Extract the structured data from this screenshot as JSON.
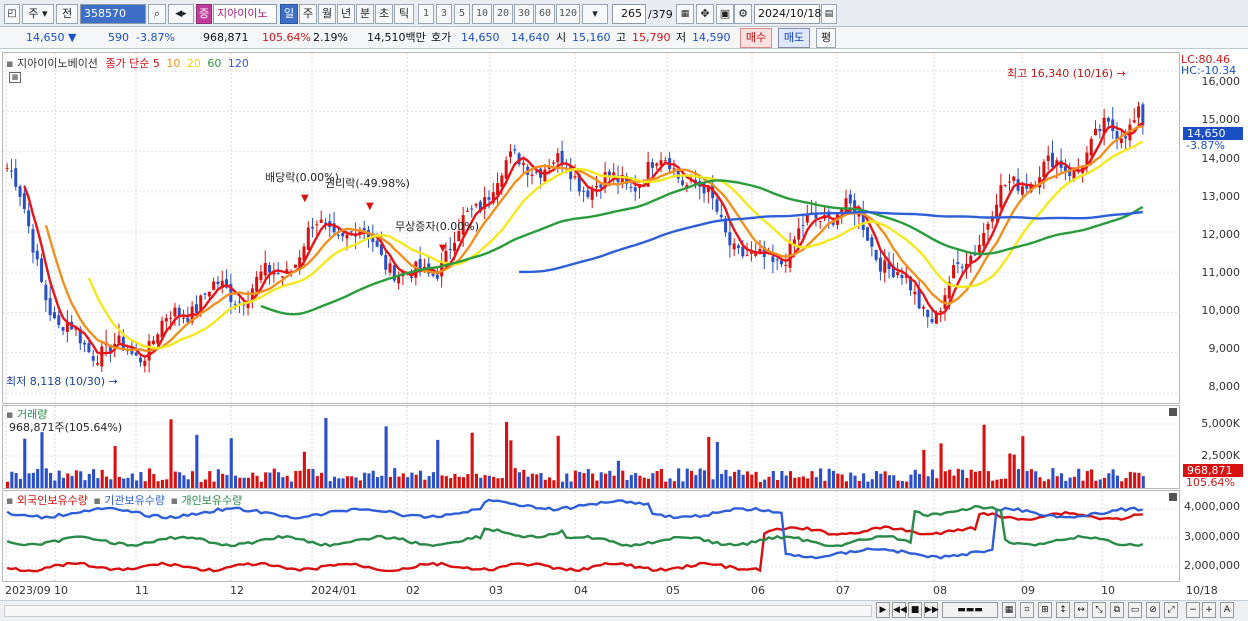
{
  "toolbar": {
    "market_label": "주",
    "prev_label": "전",
    "code": "358570",
    "stock_badge": "증",
    "stock_name": "지아이이노",
    "periods": [
      "일",
      "주",
      "월",
      "년",
      "분",
      "초",
      "틱"
    ],
    "active_period": "일",
    "intervals": [
      "1",
      "3",
      "5",
      "10",
      "20",
      "30",
      "60",
      "120"
    ],
    "count": "265",
    "total": "/379",
    "date": "2024/10/18"
  },
  "quote": {
    "price": "14,650",
    "change": "590",
    "change_pct": "-3.87%",
    "volume": "968,871",
    "volume_ratio": "105.64%",
    "turnover": "2.19%",
    "amount": "14,510백만",
    "ask_label": "호가",
    "ask": "14,650",
    "bid": "14,640",
    "open_label": "시",
    "open": "15,160",
    "high_label": "고",
    "high": "15,790",
    "low_label": "저",
    "low": "14,590",
    "buy_label": "매수",
    "sell_label": "매도",
    "flat_label": "평"
  },
  "price_panel": {
    "legend_name": "지아이이노베이션",
    "legend_type": "종가 단순",
    "ma_periods": [
      "5",
      "10",
      "20",
      "60",
      "120"
    ],
    "ma_colors": [
      "#e8141a",
      "#f0901e",
      "#f5e81e",
      "#2a9c3c",
      "#2f5fd8"
    ],
    "annotations": {
      "high": "최고 16,340 (10/16)",
      "low": "최저 8,118 (10/30)",
      "dividend": "배당락(0.00%)",
      "rights": "권리락(-49.98%)",
      "bonus": "무상증자(0.00%)"
    },
    "right_labels": {
      "lc": "LC:80.46",
      "hc": "HC:-10.34",
      "current": "14,650",
      "current_pct": "-3.87%"
    },
    "y_ticks": [
      "16,000",
      "15,000",
      "14,000",
      "13,000",
      "12,000",
      "11,000",
      "10,000",
      "9,000",
      "8,000"
    ]
  },
  "volume_panel": {
    "title": "거래량",
    "subtitle": "968,871주(105.64%)",
    "y_ticks": [
      "5,000K",
      "2,500K"
    ],
    "current": "968,871",
    "current_pct": "105.64%"
  },
  "holdings_panel": {
    "series": [
      "외국인보유수량",
      "기관보유수량",
      "개인보유수량"
    ],
    "colors": [
      "#d81010",
      "#2f5fd8",
      "#2a8a4a"
    ],
    "y_ticks": [
      "4,000,000",
      "3,000,000",
      "2,000,000"
    ]
  },
  "x_axis": {
    "labels": [
      "2023/09",
      "10",
      "11",
      "12",
      "2024/01",
      "02",
      "03",
      "04",
      "05",
      "06",
      "07",
      "08",
      "09",
      "10"
    ],
    "right": "10/18"
  },
  "chart_data": {
    "type": "candlestick",
    "title": "지아이이노베이션 일봉",
    "x_range": [
      "2023/09",
      "2024/10/18"
    ],
    "ylim": [
      8000,
      16340
    ],
    "close_series": {
      "months": [
        "2023/09",
        "10",
        "11",
        "12",
        "2024/01",
        "02",
        "03",
        "04",
        "05",
        "06",
        "07",
        "08",
        "09",
        "10"
      ],
      "approx_close": [
        13600,
        9200,
        9400,
        10300,
        12200,
        10800,
        13200,
        13600,
        13400,
        11500,
        12300,
        10300,
        13200,
        14650
      ]
    },
    "ma_lines": [
      "MA5",
      "MA10",
      "MA20",
      "MA60",
      "MA120"
    ],
    "high": 16340,
    "high_date": "10/16",
    "low": 8118,
    "low_date": "10/30"
  }
}
